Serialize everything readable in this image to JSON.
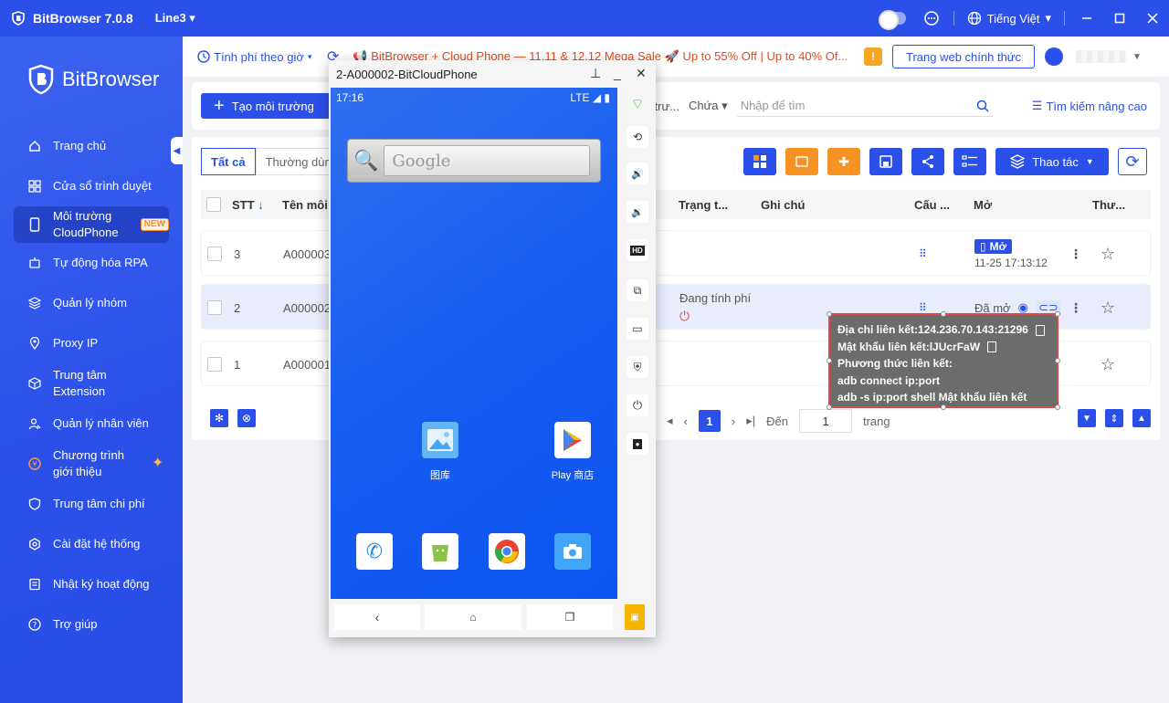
{
  "app": {
    "title": "BitBrowser 7.0.8",
    "line": "Line3",
    "language": "Tiếng Việt",
    "brand": "BitBrowser"
  },
  "sidebar": {
    "items": [
      {
        "label": "Trang chủ",
        "icon": "home-icon"
      },
      {
        "label": "Cửa sổ trình duyệt",
        "icon": "grid-icon"
      },
      {
        "label": "Môi trường CloudPhone",
        "icon": "phone-icon",
        "badge": "NEW"
      },
      {
        "label": "Tự động hóa RPA",
        "icon": "robot-icon"
      },
      {
        "label": "Quản lý nhóm",
        "icon": "layers-icon"
      },
      {
        "label": "Proxy IP",
        "icon": "location-icon"
      },
      {
        "label": "Trung tâm Extension",
        "icon": "cube-icon"
      },
      {
        "label": "Quản lý nhân viên",
        "icon": "users-icon"
      },
      {
        "label": "Chương trình giới thiệu",
        "icon": "coin-icon"
      },
      {
        "label": "Trung tâm chi phí",
        "icon": "wallet-icon"
      },
      {
        "label": "Cài đặt hệ thống",
        "icon": "gear-icon"
      },
      {
        "label": "Nhật ký hoạt động",
        "icon": "log-icon"
      },
      {
        "label": "Trợ giúp",
        "icon": "help-icon"
      }
    ]
  },
  "topbar": {
    "pricing": "Tính phí theo giờ",
    "promo": "BitBrowser + Cloud Phone — 11.11 & 12.12 Mega Sale 🚀 Up to 55% Off | Up to 40% Of...",
    "warn": "!",
    "official_site": "Trang web chính thức"
  },
  "toolbar": {
    "create": "Tạo môi trường",
    "filter_field": "i trư...",
    "filter_op": "Chứa",
    "search_placeholder": "Nhập để tìm",
    "advanced_search": "Tìm kiếm nâng cao"
  },
  "tabs": [
    "Tất cả",
    "Thường dùng"
  ],
  "actions": {
    "operation": "Thao tác"
  },
  "table": {
    "headers": {
      "stt": "STT",
      "name": "Tên môi",
      "status": "Trạng t...",
      "note": "Ghi chú",
      "config": "Cấu ...",
      "open": "Mở",
      "more": "Thư..."
    },
    "rows": [
      {
        "stt": "3",
        "name": "A000003",
        "status": "",
        "open_label": "Mở",
        "open_time": "11-25 17:13:12"
      },
      {
        "stt": "2",
        "name": "A000002",
        "status": "Đang tính phí",
        "open_label": "Đã mở"
      },
      {
        "stt": "1",
        "name": "A000001",
        "status": ""
      }
    ]
  },
  "pager": {
    "current": "1",
    "goto_label": "Đến",
    "goto_value": "1",
    "page_label": "trang"
  },
  "phone": {
    "window_title": "2-A000002-BitCloudPhone",
    "time": "17:16",
    "network": "LTE",
    "search_hint": "Google",
    "apps": [
      {
        "label": "图库"
      },
      {
        "label": "Play 商店"
      }
    ]
  },
  "popup": {
    "address_label": "Địa chỉ liên kết:",
    "address": "124.236.70.143:21296",
    "password_label": "Mật khẩu liên kết:",
    "password": "lJUcrFaW",
    "method_label": "Phương thức liên kết:",
    "cmd1": "adb connect ip:port",
    "cmd2": "adb -s ip:port shell Mật khẩu liên kết"
  },
  "colors": {
    "primary": "#2b50e9",
    "orange": "#f79325",
    "promo": "#e64a19",
    "danger": "#e04848"
  }
}
